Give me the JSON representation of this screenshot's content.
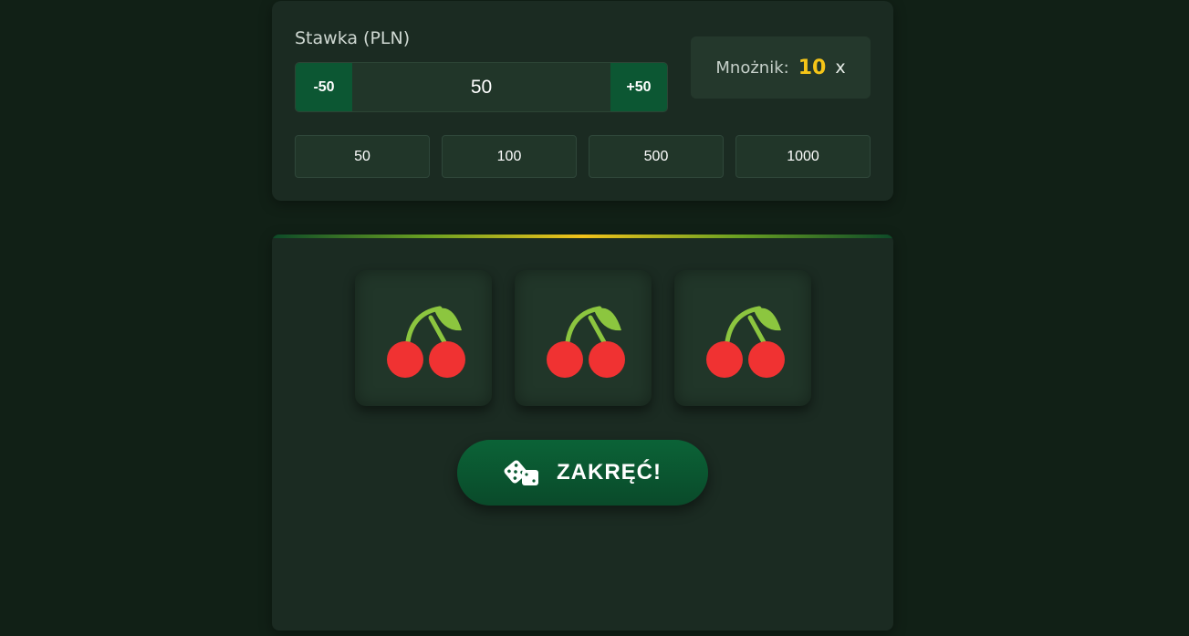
{
  "bet": {
    "label": "Stawka (PLN)",
    "decrement_label": "-50",
    "value": "50",
    "increment_label": "+50",
    "quick_amounts": [
      "50",
      "100",
      "500",
      "1000"
    ]
  },
  "multiplier": {
    "label": "Mnożnik:",
    "value": "10",
    "suffix": "x"
  },
  "reels": [
    {
      "symbol": "cherry-icon"
    },
    {
      "symbol": "cherry-icon"
    },
    {
      "symbol": "cherry-icon"
    }
  ],
  "spin": {
    "label": "ZAKRĘĆ!",
    "icon": "dice-icon"
  },
  "colors": {
    "background": "#112016",
    "panel": "#1b2b22",
    "accent_green": "#0c5733",
    "gold": "#f5c518",
    "cherry_red": "#f03232",
    "stem_green": "#8cc63f"
  }
}
